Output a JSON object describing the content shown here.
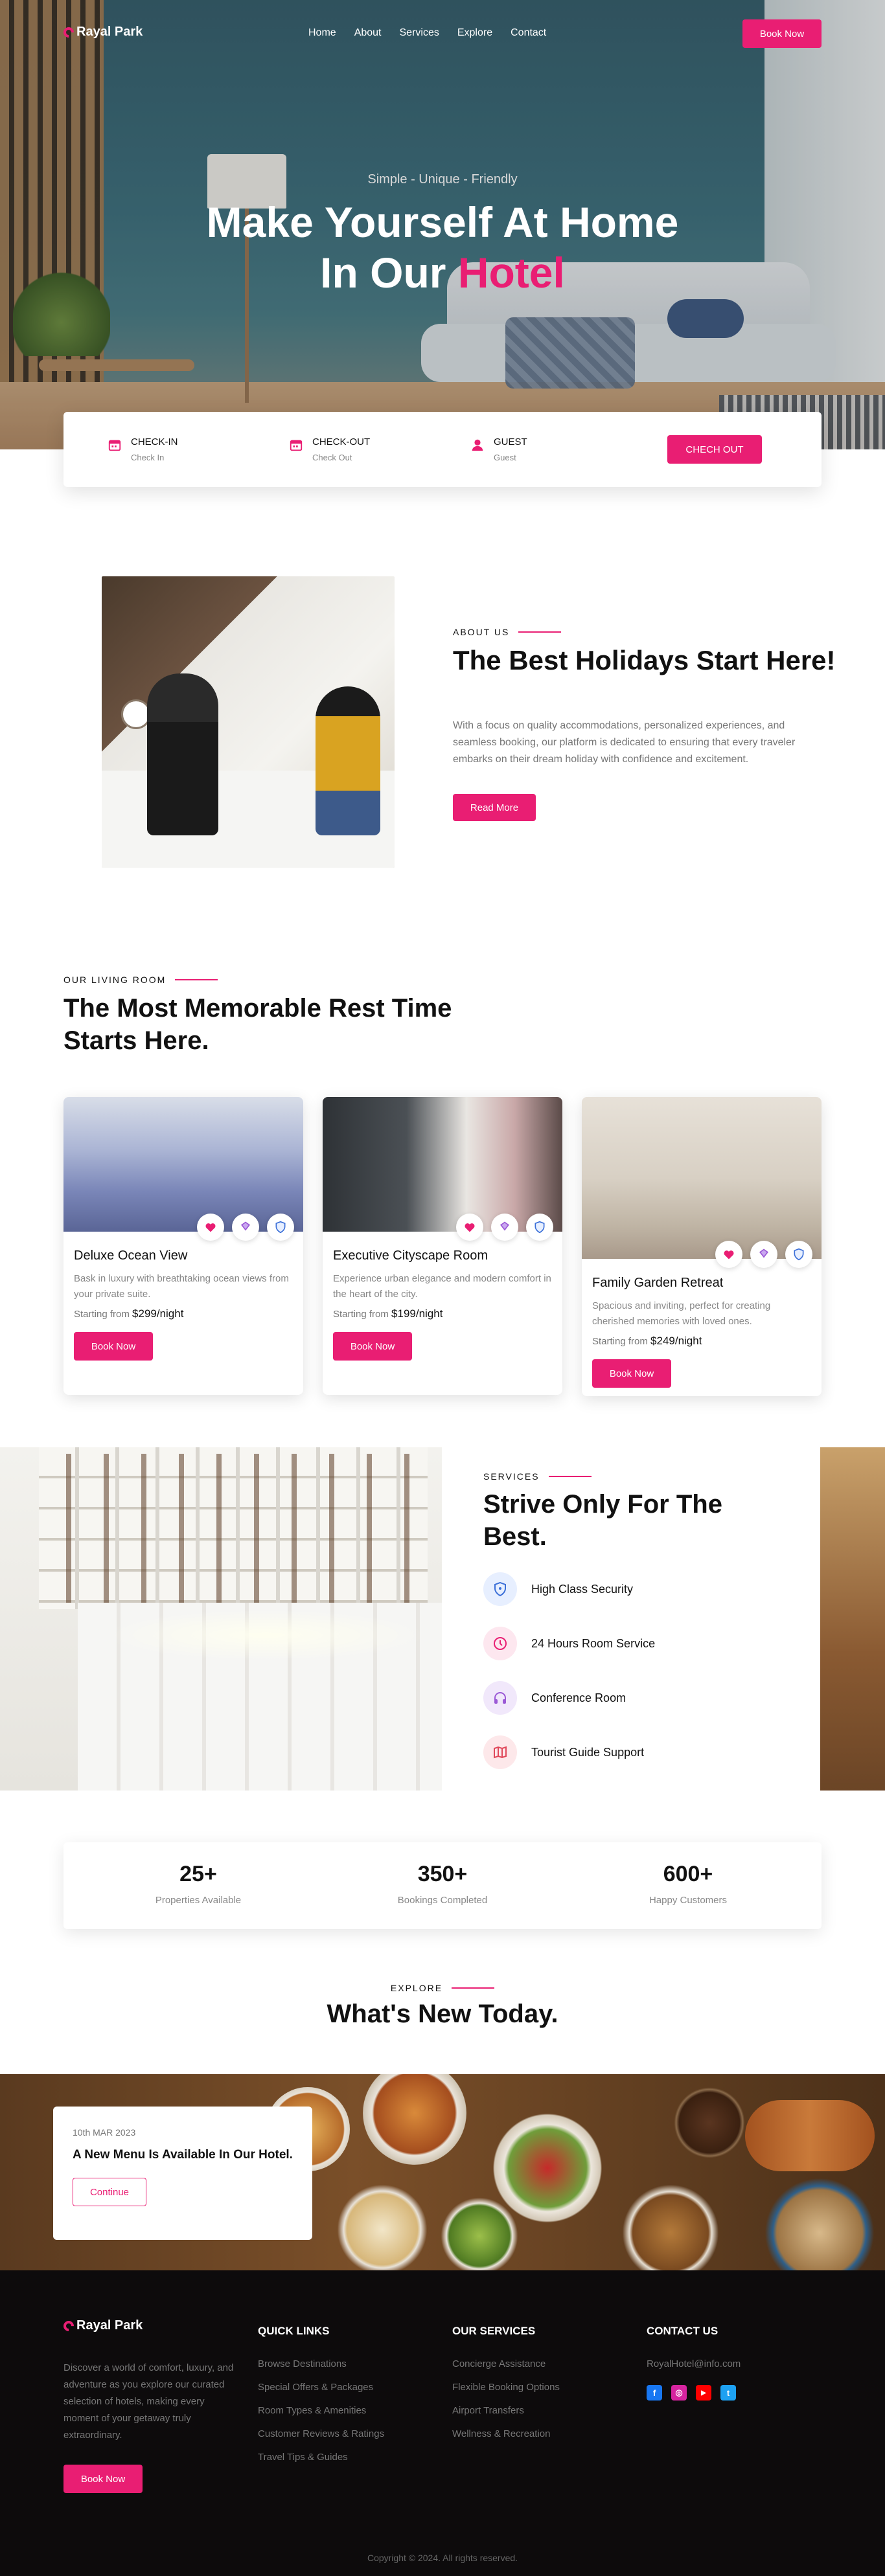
{
  "nav": {
    "brand": "Rayal Park",
    "links": [
      "Home",
      "About",
      "Services",
      "Explore",
      "Contact"
    ],
    "book_label": "Book Now"
  },
  "hero": {
    "tagline": "Simple - Unique - Friendly",
    "title_line1": "Make Yourself At Home",
    "title_line2_prefix": "In Our ",
    "title_highlight": "Hotel"
  },
  "booking": {
    "checkin_label": "CHECK-IN",
    "checkin_value": "Check In",
    "checkout_label": "CHECK-OUT",
    "checkout_value": "Check Out",
    "guest_label": "GUEST",
    "guest_value": "Guest",
    "button": "CHECH OUT"
  },
  "about": {
    "eyebrow": "ABOUT US",
    "title": "The Best Holidays Start Here!",
    "text": "With a focus on quality accommodations, personalized experiences, and seamless booking, our platform is dedicated to ensuring that every traveler embarks on their dream holiday with confidence and excitement.",
    "button": "Read More"
  },
  "rooms": {
    "eyebrow": "OUR LIVING ROOM",
    "title": "The Most Memorable Rest Time Starts Here.",
    "items": [
      {
        "name": "Deluxe Ocean View",
        "desc": "Bask in luxury with breathtaking ocean views from your private suite.",
        "price_prefix": "Starting from ",
        "price": "$299/night",
        "button": "Book Now"
      },
      {
        "name": "Executive Cityscape Room",
        "desc": "Experience urban elegance and modern comfort in the heart of the city.",
        "price_prefix": "Starting from ",
        "price": "$199/night",
        "button": "Book Now"
      },
      {
        "name": "Family Garden Retreat",
        "desc": "Spacious and inviting, perfect for creating cherished memories with loved ones.",
        "price_prefix": "Starting from ",
        "price": "$249/night",
        "button": "Book Now"
      }
    ]
  },
  "services": {
    "eyebrow": "SERVICES",
    "title": "Strive Only For The Best.",
    "items": [
      {
        "label": "High Class Security",
        "icon": "shield-icon",
        "bg": "#e7efff",
        "color": "#3b6fd8"
      },
      {
        "label": "24 Hours Room Service",
        "icon": "clock-icon",
        "bg": "#fde7ef",
        "color": "#e91e73"
      },
      {
        "label": "Conference Room",
        "icon": "headphones-icon",
        "bg": "#f1e8fb",
        "color": "#9b59d6"
      },
      {
        "label": "Tourist Guide Support",
        "icon": "map-icon",
        "bg": "#fde8ea",
        "color": "#e0485a"
      }
    ]
  },
  "stats": [
    {
      "value": "25+",
      "label": "Properties Available"
    },
    {
      "value": "350+",
      "label": "Bookings Completed"
    },
    {
      "value": "600+",
      "label": "Happy Customers"
    }
  ],
  "explore": {
    "eyebrow": "EXPLORE",
    "title": "What's New Today.",
    "news_date": "10th MAR 2023",
    "news_title": "A New Menu Is Available In Our Hotel.",
    "news_button": "Continue"
  },
  "footer": {
    "brand": "Rayal Park",
    "about": "Discover a world of comfort, luxury, and adventure as you explore our curated selection of hotels, making every moment of your getaway truly extraordinary.",
    "book_label": "Book Now",
    "quick_links_title": "QUICK LINKS",
    "quick_links": [
      "Browse Destinations",
      "Special Offers & Packages",
      "Room Types & Amenities",
      "Customer Reviews & Ratings",
      "Travel Tips & Guides"
    ],
    "services_title": "OUR SERVICES",
    "services": [
      "Concierge Assistance",
      "Flexible Booking Options",
      "Airport Transfers",
      "Wellness & Recreation"
    ],
    "contact_title": "CONTACT US",
    "email": "RoyalHotel@info.com",
    "socials": [
      {
        "name": "facebook-icon",
        "glyph": "f",
        "color": "#1877f2"
      },
      {
        "name": "instagram-icon",
        "glyph": "◎",
        "color": "#d6249f"
      },
      {
        "name": "youtube-icon",
        "glyph": "▶",
        "color": "#ff0000"
      },
      {
        "name": "twitter-icon",
        "glyph": "t",
        "color": "#1da1f2"
      }
    ],
    "copyright": "Copyright © 2024. All rights reserved."
  },
  "colors": {
    "accent": "#e91e73",
    "footer_bg": "#0d0b0c"
  }
}
